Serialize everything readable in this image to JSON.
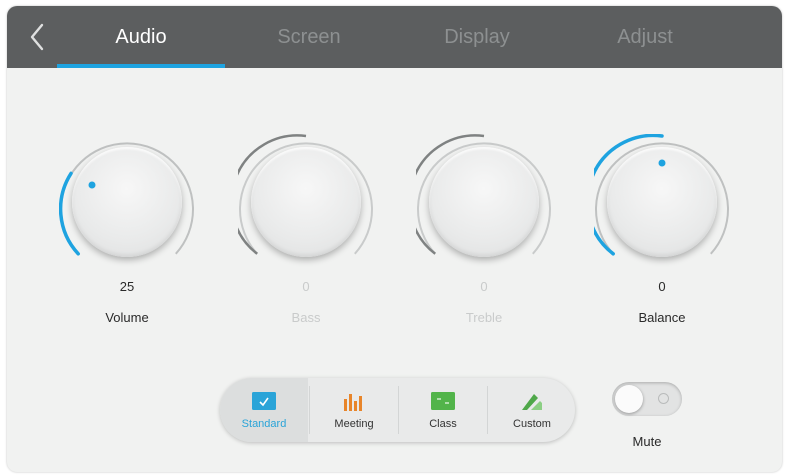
{
  "tabs": [
    {
      "label": "Audio",
      "active": true
    },
    {
      "label": "Screen",
      "active": false
    },
    {
      "label": "Display",
      "active": false
    },
    {
      "label": "Adjust",
      "active": false
    }
  ],
  "knobs": [
    {
      "label": "Volume",
      "value": "25",
      "enabled": true
    },
    {
      "label": "Bass",
      "value": "0",
      "enabled": false
    },
    {
      "label": "Treble",
      "value": "0",
      "enabled": false
    },
    {
      "label": "Balance",
      "value": "0",
      "enabled": true
    }
  ],
  "modes": [
    {
      "label": "Standard",
      "icon": "standard-icon",
      "selected": true
    },
    {
      "label": "Meeting",
      "icon": "meeting-icon",
      "selected": false
    },
    {
      "label": "Class",
      "icon": "class-icon",
      "selected": false
    },
    {
      "label": "Custom",
      "icon": "custom-icon",
      "selected": false
    }
  ],
  "mute": {
    "label": "Mute",
    "on": false
  },
  "colors": {
    "accent": "#1ea3e0",
    "topbar": "#5c5e5f",
    "panel": "#f1f2f1"
  }
}
